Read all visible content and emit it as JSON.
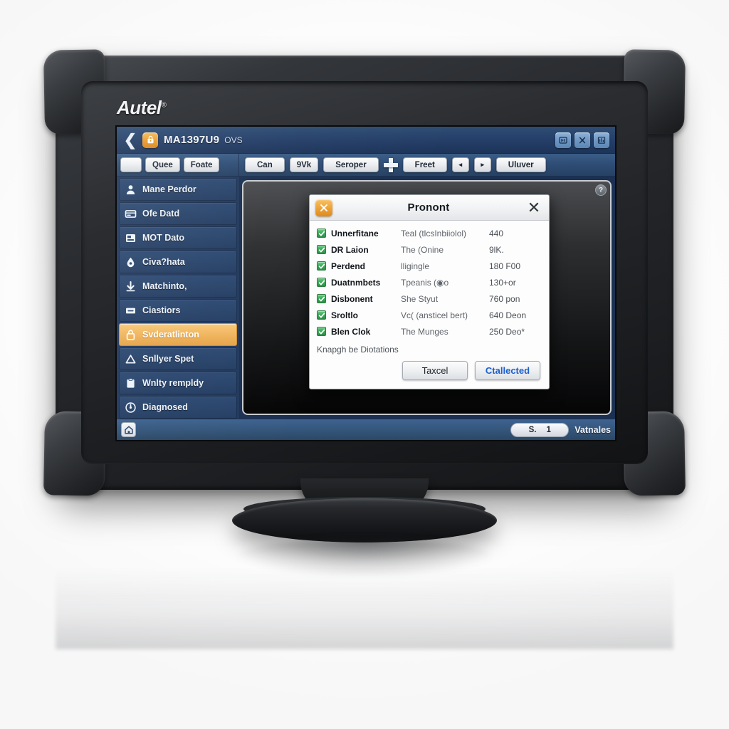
{
  "device": {
    "brand": "Autel",
    "brand_mark": "®"
  },
  "titlebar": {
    "back_icon": "back-chevron-icon",
    "badge_icon": "app-badge-icon",
    "title": "MA1397U9",
    "subtitle": "OVS",
    "icons": [
      {
        "name": "vci-status-icon",
        "glyph": "FC"
      },
      {
        "name": "settings-tool-icon",
        "glyph": "X"
      },
      {
        "name": "report-icon",
        "glyph": "▥"
      }
    ]
  },
  "toolbar": {
    "left_buttons": [
      {
        "label": "",
        "name": "toolbar-blank-button"
      },
      {
        "label": "Quee",
        "name": "toolbar-quee-button"
      },
      {
        "label": "Foate",
        "name": "toolbar-foate-button"
      }
    ],
    "right_buttons": [
      {
        "label": "Can",
        "name": "toolbar-can-button"
      },
      {
        "label": "9Vk",
        "name": "toolbar-9vk-button"
      },
      {
        "label": "Seroper",
        "name": "toolbar-seroper-button"
      }
    ],
    "plus_icon": "plus-icon",
    "after_plus_buttons": [
      {
        "label": "Freet",
        "name": "toolbar-freet-button"
      },
      {
        "label": "◂",
        "name": "toolbar-prev-button"
      },
      {
        "label": "▸",
        "name": "toolbar-next-button"
      },
      {
        "label": "Uluver",
        "name": "toolbar-uluver-button"
      }
    ]
  },
  "sidebar": {
    "items": [
      {
        "label": "Mane Perdor",
        "icon": "person-icon",
        "active": false
      },
      {
        "label": "Ofe Datd",
        "icon": "card-icon",
        "active": false
      },
      {
        "label": "MOT Dato",
        "icon": "printer-icon",
        "active": false
      },
      {
        "label": "Civa?hata",
        "icon": "droplet-icon",
        "active": false
      },
      {
        "label": "Matchinto,",
        "icon": "download-icon",
        "active": false
      },
      {
        "label": "Ciastiors",
        "icon": "minus-box-icon",
        "active": false
      },
      {
        "label": "Svderatlinton",
        "icon": "lock-icon",
        "active": true
      },
      {
        "label": "Snllyer Spet",
        "icon": "triangle-icon",
        "active": false
      },
      {
        "label": "Wnlty rempldy",
        "icon": "clipboard-icon",
        "active": false
      },
      {
        "label": "Diagnosed",
        "icon": "gauge-icon",
        "active": false
      }
    ]
  },
  "content": {
    "help_icon": "help-circle-icon",
    "help_glyph": "?"
  },
  "dialog": {
    "icon": "wrench-tool-icon",
    "icon_glyph": "✕",
    "title": "Pronont",
    "close_icon": "close-icon",
    "rows": [
      {
        "checked": true,
        "name": "Unnerfitane",
        "desc": "Teal (tlcsInbiiolol)",
        "value": "440"
      },
      {
        "checked": true,
        "name": "DR Laion",
        "desc": "The (Onine",
        "value": "9lK."
      },
      {
        "checked": true,
        "name": "Perdend",
        "desc": "lligingle",
        "value": "180 F00"
      },
      {
        "checked": true,
        "name": "Duatnmbets",
        "desc": "Tpeanis (◉o",
        "value": "130+or"
      },
      {
        "checked": true,
        "name": "Disbonent",
        "desc": "She Styut",
        "value": "760 pon"
      },
      {
        "checked": true,
        "name": "Sroltlo",
        "desc": "Vc( (ansticel bert)",
        "value": "640 Deon"
      },
      {
        "checked": true,
        "name": "Blen Clok",
        "desc": "The Munges",
        "value": "250 Deo*"
      }
    ],
    "note": "Knapgh be Diotations",
    "cancel_label": "Taxcel",
    "confirm_label": "Ctallected"
  },
  "statusbar": {
    "home_icon": "home-icon",
    "page_prefix": "S.",
    "page_number": "1",
    "label": "Vatnales"
  },
  "colors": {
    "accent_orange": "#efb35b",
    "titlebar_blue": "#25406a",
    "toolbar_blue": "#2e4c74",
    "sidebar_blue": "#22395d",
    "statusbar_blue": "#345579",
    "check_green": "#35a653",
    "primary_link": "#1c5fd0"
  }
}
